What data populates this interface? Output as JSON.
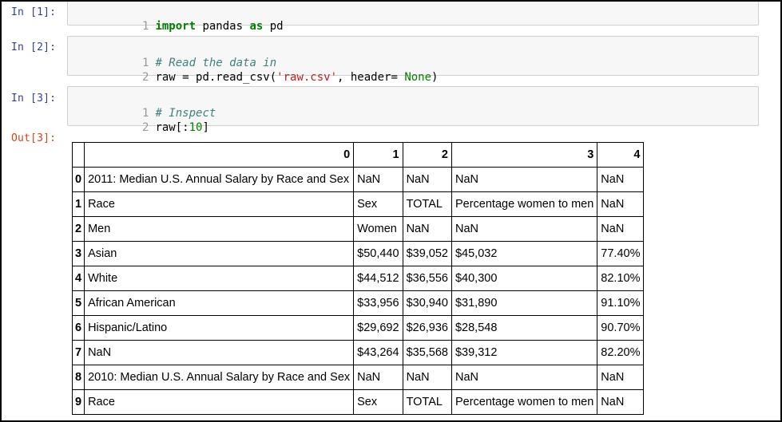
{
  "cells": [
    {
      "prompt": "In [1]:",
      "lines": [
        {
          "num": "1",
          "tokens": [
            {
              "t": "import",
              "c": "kw"
            },
            {
              "t": " pandas ",
              "c": ""
            },
            {
              "t": "as",
              "c": "kw"
            },
            {
              "t": " pd",
              "c": ""
            }
          ]
        }
      ]
    },
    {
      "prompt": "In [2]:",
      "lines": [
        {
          "num": "1",
          "tokens": [
            {
              "t": "# Read the data in",
              "c": "cm"
            }
          ]
        },
        {
          "num": "2",
          "tokens": [
            {
              "t": "raw = pd.read_csv(",
              "c": ""
            },
            {
              "t": "'raw.csv'",
              "c": "st"
            },
            {
              "t": ", header= ",
              "c": ""
            },
            {
              "t": "None",
              "c": "nm"
            },
            {
              "t": ")",
              "c": ""
            }
          ]
        }
      ]
    },
    {
      "prompt": "In [3]:",
      "lines": [
        {
          "num": "1",
          "tokens": [
            {
              "t": "# Inspect",
              "c": "cm"
            }
          ]
        },
        {
          "num": "2",
          "tokens": [
            {
              "t": "raw[:",
              "c": ""
            },
            {
              "t": "10",
              "c": "nm"
            },
            {
              "t": "]",
              "c": ""
            }
          ]
        }
      ]
    }
  ],
  "output": {
    "prompt": "Out[3]:",
    "columns": [
      "",
      "0",
      "1",
      "2",
      "3",
      "4"
    ],
    "rows": [
      {
        "index": "0",
        "cells": [
          "2011: Median U.S. Annual Salary by Race and Sex",
          "NaN",
          "NaN",
          "NaN",
          "NaN"
        ]
      },
      {
        "index": "1",
        "cells": [
          "Race",
          "Sex",
          "TOTAL",
          "Percentage women to men",
          "NaN"
        ]
      },
      {
        "index": "2",
        "cells": [
          "Men",
          "Women",
          "NaN",
          "NaN",
          "NaN"
        ]
      },
      {
        "index": "3",
        "cells": [
          "Asian",
          "$50,440",
          "$39,052",
          "$45,032",
          "77.40%"
        ]
      },
      {
        "index": "4",
        "cells": [
          "White",
          "$44,512",
          "$36,556",
          "$40,300",
          "82.10%"
        ]
      },
      {
        "index": "5",
        "cells": [
          "African American",
          "$33,956",
          "$30,940",
          "$31,890",
          "91.10%"
        ]
      },
      {
        "index": "6",
        "cells": [
          "Hispanic/Latino",
          "$29,692",
          "$26,936",
          "$28,548",
          "90.70%"
        ]
      },
      {
        "index": "7",
        "cells": [
          "NaN",
          "$43,264",
          "$35,568",
          "$39,312",
          "82.20%"
        ]
      },
      {
        "index": "8",
        "cells": [
          "2010: Median U.S. Annual Salary by Race and Sex",
          "NaN",
          "NaN",
          "NaN",
          "NaN"
        ]
      },
      {
        "index": "9",
        "cells": [
          "Race",
          "Sex",
          "TOTAL",
          "Percentage women to men",
          "NaN"
        ]
      }
    ]
  }
}
